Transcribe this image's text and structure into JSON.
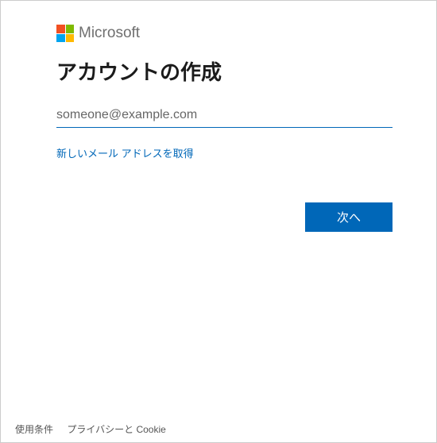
{
  "header": {
    "brand": "Microsoft"
  },
  "main": {
    "title": "アカウントの作成",
    "email_placeholder": "someone@example.com",
    "email_value": "",
    "new_email_link": "新しいメール アドレスを取得",
    "next_button": "次へ"
  },
  "footer": {
    "terms": "使用条件",
    "privacy": "プライバシーと Cookie"
  },
  "colors": {
    "accent": "#0067b8"
  }
}
